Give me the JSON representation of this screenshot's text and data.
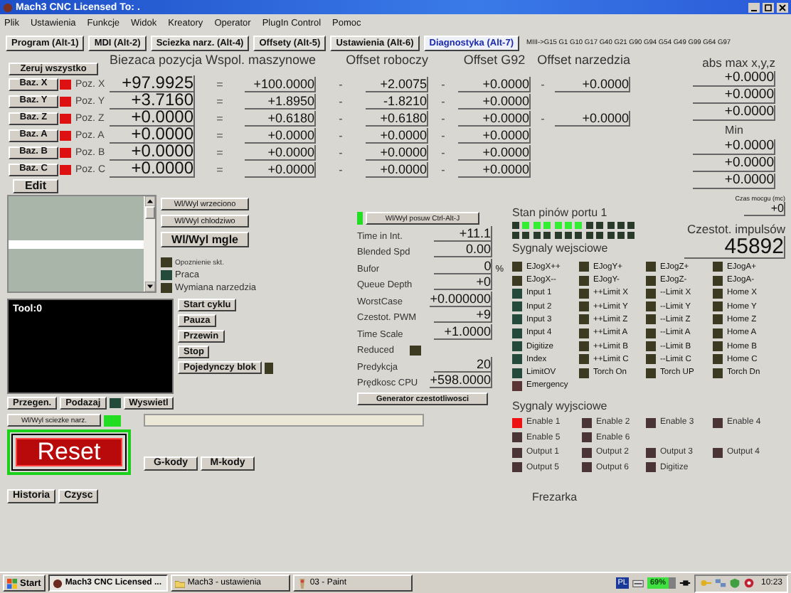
{
  "window": {
    "title": "Mach3 CNC  Licensed To: ."
  },
  "menu": [
    "Plik",
    "Ustawienia",
    "Funkcje",
    "Widok",
    "Kreatory",
    "Operator",
    "PlugIn Control",
    "Pomoc"
  ],
  "tabs": [
    {
      "label": "Program (Alt-1)",
      "selected": false
    },
    {
      "label": "MDI (Alt-2)",
      "selected": false
    },
    {
      "label": "Sciezka narz. (Alt-4)",
      "selected": false
    },
    {
      "label": "Offsety (Alt-5)",
      "selected": false
    },
    {
      "label": "Ustawienia (Alt-6)",
      "selected": false
    },
    {
      "label": "Diagnostyka (Alt-7)",
      "selected": true
    }
  ],
  "modal_line": "MIII->G15  G1 G10 G17 G40 G21 G90 G94 G54 G49 G99 G64 G97",
  "positions": {
    "zero_all": "Zeruj wszystko",
    "headers": [
      "Biezaca pozycja",
      "Wspol. maszynowe",
      "Offset roboczy",
      "Offset G92",
      "Offset narzedzia"
    ],
    "rows": [
      {
        "axis_button": "Baz. X",
        "referenced": false,
        "label": "Poz. X",
        "current": "+97.9925",
        "sep_machine": "=",
        "machine": "+100.0000",
        "sep_work": "-",
        "work": "+2.0075",
        "sep_g92": "-",
        "g92": "+0.0000",
        "sep_tool": "-",
        "tool": "+0.0000"
      },
      {
        "axis_button": "Baz. Y",
        "referenced": false,
        "label": "Poz. Y",
        "current": "+3.7160",
        "sep_machine": "=",
        "machine": "+1.8950",
        "sep_work": "-",
        "work": "-1.8210",
        "sep_g92": "-",
        "g92": "+0.0000"
      },
      {
        "axis_button": "Baz. Z",
        "referenced": false,
        "label": "Poz. Z",
        "current": "+0.0000",
        "sep_machine": "=",
        "machine": "+0.6180",
        "sep_work": "-",
        "work": "+0.6180",
        "sep_g92": "-",
        "g92": "+0.0000",
        "sep_tool": "-",
        "tool": "+0.0000"
      },
      {
        "axis_button": "Baz. A",
        "referenced": false,
        "label": "Poz. A",
        "current": "+0.0000",
        "sep_machine": "=",
        "machine": "+0.0000",
        "sep_work": "-",
        "work": "+0.0000",
        "sep_g92": "-",
        "g92": "+0.0000"
      },
      {
        "axis_button": "Baz. B",
        "referenced": false,
        "label": "Poz. B",
        "current": "+0.0000",
        "sep_machine": "=",
        "machine": "+0.0000",
        "sep_work": "-",
        "work": "+0.0000",
        "sep_g92": "-",
        "g92": "+0.0000"
      },
      {
        "axis_button": "Baz. C",
        "referenced": false,
        "label": "Poz. C",
        "current": "+0.0000",
        "sep_machine": "=",
        "machine": "+0.0000",
        "sep_work": "-",
        "work": "+0.0000",
        "sep_g92": "-",
        "g92": "+0.0000"
      }
    ]
  },
  "edit_button": "Edit",
  "abs": {
    "title": "abs max x,y,z",
    "max": [
      "+0.0000",
      "+0.0000",
      "+0.0000"
    ],
    "min_title": "Min",
    "min": [
      "+0.0000",
      "+0.0000",
      "+0.0000"
    ]
  },
  "spindle_buttons": [
    "Wl/Wyl wrzeciono",
    "Wl/Wyl chlodziwo",
    "Wl/Wyl mgle"
  ],
  "status_leds": [
    {
      "label": "Opoznienie skt.",
      "color": "#3d3a22"
    },
    {
      "label": "Praca",
      "color": "#234a3a"
    },
    {
      "label": "Wymiana narzedzia",
      "color": "#3d3a22"
    }
  ],
  "tool_display": "Tool:0",
  "cycle_buttons": [
    "Start cyklu",
    "Pauza",
    "Przewin",
    "Stop"
  ],
  "single_block": {
    "label": "Pojedynczy blok",
    "on": false
  },
  "view_row": {
    "buttons": [
      "Przegen.",
      "Podazaj"
    ],
    "follow_on": false,
    "display_button": "Wyswietl"
  },
  "toolpath": {
    "label": "Wl/Wyl sciezke narz.",
    "on": true
  },
  "reset_button": "Reset",
  "history_buttons": [
    "Historia",
    "Czysc"
  ],
  "code_buttons": [
    "G-kody",
    "M-kody"
  ],
  "diagnostics": {
    "feed_button": {
      "label": "Wl/Wyl posuw Ctrl-Alt-J",
      "on": true
    },
    "rows": [
      {
        "kind": "value",
        "label": "Time in Int.",
        "value": "+11.1"
      },
      {
        "kind": "value",
        "label": "Blended Spd",
        "value": "0.00"
      },
      {
        "kind": "value",
        "label": "Bufor",
        "value": "0",
        "unit": "%"
      },
      {
        "kind": "value",
        "label": "Queue Depth",
        "value": "+0"
      },
      {
        "kind": "value",
        "label": "WorstCase",
        "value": "+0.000000"
      },
      {
        "kind": "value",
        "label": "Czestot. PWM",
        "value": "+9"
      },
      {
        "kind": "value",
        "label": "Time Scale",
        "value": "+1.0000"
      },
      {
        "kind": "led",
        "label": "Reduced",
        "on": false
      },
      {
        "kind": "value",
        "label": "Predykcja",
        "value": "20"
      },
      {
        "kind": "value",
        "label": "Prędkosc CPU",
        "value": "+598.0000"
      }
    ],
    "generator_button": "Generator czestotliwosci"
  },
  "port": {
    "title": "Stan pinów portu 1",
    "rows": [
      [
        {
          "on": false
        },
        {
          "on": true
        },
        {
          "on": true
        },
        {
          "on": true
        },
        {
          "on": true
        },
        {
          "on": true
        },
        {
          "on": true
        },
        {
          "on": false
        },
        {
          "on": false
        },
        {
          "on": false
        },
        {
          "on": false
        },
        {
          "on": false
        }
      ],
      [
        {
          "on": false
        },
        {
          "on": false
        },
        {
          "on": false
        },
        {
          "on": false
        },
        {
          "on": false
        },
        {
          "on": false
        },
        {
          "on": false
        },
        {
          "on": false
        },
        {
          "on": false
        },
        {
          "on": false
        },
        {
          "on": false
        },
        {
          "on": false
        }
      ]
    ]
  },
  "kernel": {
    "label": "Czas mocgu (mc)",
    "value": "+0"
  },
  "pulse": {
    "label": "Czestot. impulsów",
    "value": "45892"
  },
  "inputs": {
    "title": "Sygnaly wejsciowe",
    "signals": [
      {
        "label": "EJogX++",
        "color": "#3d3a22"
      },
      {
        "label": "EJogY+",
        "color": "#3d3a22"
      },
      {
        "label": "EJogZ+",
        "color": "#3d3a22"
      },
      {
        "label": "EJogA+",
        "color": "#3d3a22"
      },
      {
        "label": "EJogX--",
        "color": "#3d3a22"
      },
      {
        "label": "EJogY-",
        "color": "#3d3a22"
      },
      {
        "label": "EJogZ-",
        "color": "#3d3a22"
      },
      {
        "label": "EJogA-",
        "color": "#3d3a22"
      },
      {
        "label": "Input 1",
        "color": "#234a3a"
      },
      {
        "label": "++Limit X",
        "color": "#3d3a22"
      },
      {
        "label": "--Limit X",
        "color": "#3d3a22"
      },
      {
        "label": "Home X",
        "color": "#3d3a22"
      },
      {
        "label": "Input 2",
        "color": "#234a3a"
      },
      {
        "label": "++Limit Y",
        "color": "#3d3a22"
      },
      {
        "label": "--Limit Y",
        "color": "#3d3a22"
      },
      {
        "label": "Home Y",
        "color": "#3d3a22"
      },
      {
        "label": "Input 3",
        "color": "#234a3a"
      },
      {
        "label": "++Limit Z",
        "color": "#3d3a22"
      },
      {
        "label": "--Limit Z",
        "color": "#3d3a22"
      },
      {
        "label": "Home Z",
        "color": "#3d3a22"
      },
      {
        "label": "Input 4",
        "color": "#234a3a"
      },
      {
        "label": "++Limit A",
        "color": "#3d3a22"
      },
      {
        "label": "--Limit A",
        "color": "#3d3a22"
      },
      {
        "label": "Home A",
        "color": "#3d3a22"
      },
      {
        "label": "Digitize",
        "color": "#234a3a"
      },
      {
        "label": "++Limit B",
        "color": "#3d3a22"
      },
      {
        "label": "--Limit B",
        "color": "#3d3a22"
      },
      {
        "label": "Home B",
        "color": "#3d3a22"
      },
      {
        "label": "Index",
        "color": "#234a3a"
      },
      {
        "label": "++Limit C",
        "color": "#3d3a22"
      },
      {
        "label": "--Limit C",
        "color": "#3d3a22"
      },
      {
        "label": "Home C",
        "color": "#3d3a22"
      },
      {
        "label": "LimitOV",
        "color": "#234a3a"
      },
      {
        "label": "Torch On",
        "color": "#3d3a22"
      },
      {
        "label": "Torch UP",
        "color": "#3d3a22"
      },
      {
        "label": "Torch Dn",
        "color": "#3d3a22"
      },
      {
        "label": "Emergency",
        "color": "#5a3535"
      }
    ]
  },
  "outputs": {
    "title": "Sygnaly wyjsciowe",
    "rows": [
      [
        {
          "label": "Enable 1",
          "color": "#ee1111"
        },
        {
          "label": "Enable 2",
          "color": "#4a3434"
        },
        {
          "label": "Enable 3",
          "color": "#4a3434"
        },
        {
          "label": "Enable 4",
          "color": "#4a3434"
        }
      ],
      [
        {
          "label": "Enable 5",
          "color": "#4a3434"
        },
        {
          "label": "Enable 6",
          "color": "#4a3434"
        }
      ],
      [
        {
          "label": "Output 1",
          "color": "#4a3434"
        },
        {
          "label": "Output 2",
          "color": "#4a3434"
        },
        {
          "label": "Output 3",
          "color": "#4a3434"
        },
        {
          "label": "Output 4",
          "color": "#4a3434"
        }
      ],
      [
        {
          "label": "Output 5",
          "color": "#4a3434"
        },
        {
          "label": "Output 6",
          "color": "#4a3434"
        },
        {
          "label": "Digitize",
          "color": "#4a3434"
        }
      ]
    ]
  },
  "machine_type": "Frezarka",
  "taskbar": {
    "start": "Start",
    "tasks": [
      {
        "label": "Mach3 CNC  Licensed ...",
        "selected": true
      },
      {
        "label": "Mach3 - ustawienia",
        "selected": false
      },
      {
        "label": "03 - Paint",
        "selected": false
      }
    ],
    "language": "PL",
    "battery": "69%",
    "clock": "10:23"
  }
}
